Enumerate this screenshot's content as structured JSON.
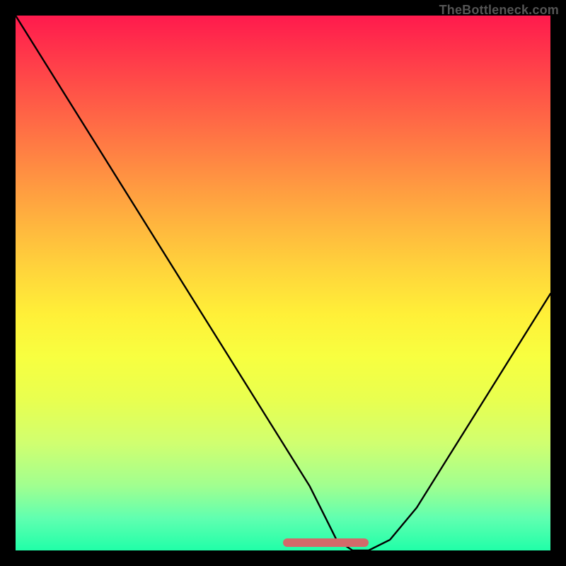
{
  "watermark": "TheBottleneck.com",
  "chart_data": {
    "type": "line",
    "title": "",
    "xlabel": "",
    "ylabel": "",
    "xlim": [
      0,
      100
    ],
    "ylim": [
      0,
      100
    ],
    "legend": false,
    "grid": false,
    "gradient_stops": [
      {
        "pos": 0,
        "color": "#ff1a4d"
      },
      {
        "pos": 20,
        "color": "#ff7a44"
      },
      {
        "pos": 40,
        "color": "#ffb93e"
      },
      {
        "pos": 60,
        "color": "#fff038"
      },
      {
        "pos": 80,
        "color": "#d0ff70"
      },
      {
        "pos": 100,
        "color": "#20ffa8"
      }
    ],
    "series": [
      {
        "name": "bottleneck-curve",
        "x": [
          0,
          5,
          10,
          15,
          20,
          25,
          30,
          35,
          40,
          45,
          50,
          55,
          58,
          60,
          63,
          66,
          70,
          75,
          80,
          85,
          90,
          95,
          100
        ],
        "y": [
          100,
          92,
          84,
          76,
          68,
          60,
          52,
          44,
          36,
          28,
          20,
          12,
          6,
          2,
          0,
          0,
          2,
          8,
          16,
          24,
          32,
          40,
          48
        ]
      }
    ],
    "annotations": [
      {
        "name": "optimal-band",
        "x_start": 50,
        "x_end": 66,
        "color": "#d36a6a"
      }
    ]
  }
}
